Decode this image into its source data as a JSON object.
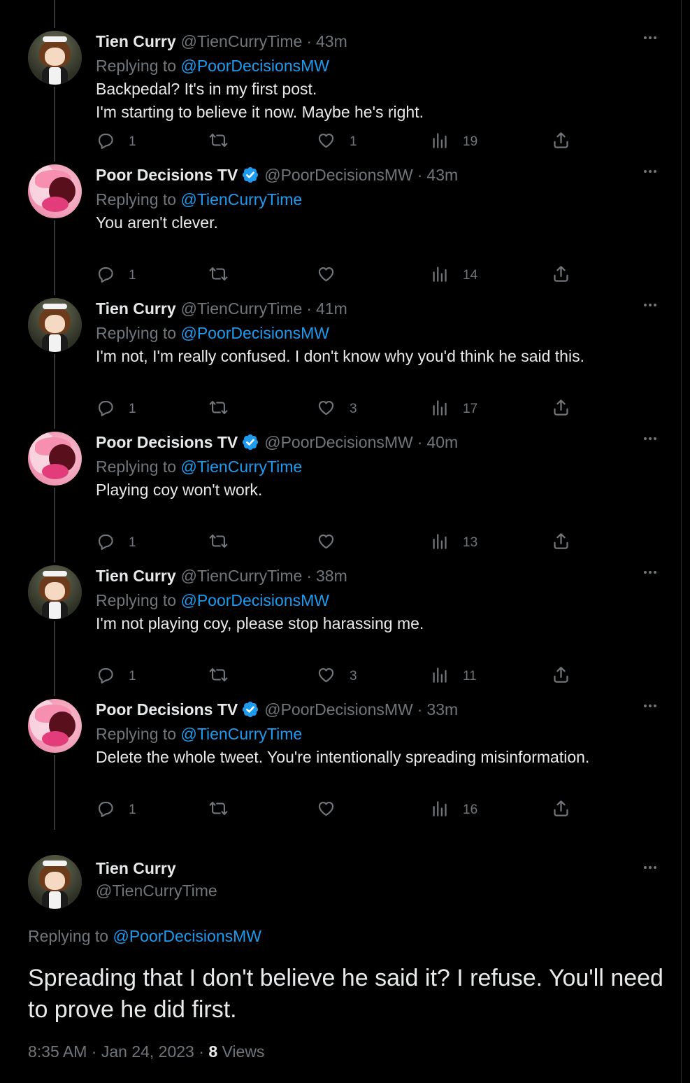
{
  "tweets": [
    {
      "author": "Tien Curry",
      "handle": "@TienCurryTime",
      "time": "43m",
      "verified": false,
      "replying_prefix": "Replying to",
      "replying_to": "@PoorDecisionsMW",
      "text": [
        "Backpedal? It's in my first post.",
        "I'm starting to believe it now. Maybe he's right."
      ],
      "replies": "1",
      "retweets": "",
      "likes": "1",
      "views": "19"
    },
    {
      "author": "Poor Decisions TV",
      "handle": "@PoorDecisionsMW",
      "time": "43m",
      "verified": true,
      "replying_prefix": "Replying to",
      "replying_to": "@TienCurryTime",
      "text": [
        "You aren't clever."
      ],
      "replies": "1",
      "retweets": "",
      "likes": "",
      "views": "14"
    },
    {
      "author": "Tien Curry",
      "handle": "@TienCurryTime",
      "time": "41m",
      "verified": false,
      "replying_prefix": "Replying to",
      "replying_to": "@PoorDecisionsMW",
      "text": [
        "I'm not, I'm really confused. I don't know why you'd think he said this."
      ],
      "replies": "1",
      "retweets": "",
      "likes": "3",
      "views": "17"
    },
    {
      "author": "Poor Decisions TV",
      "handle": "@PoorDecisionsMW",
      "time": "40m",
      "verified": true,
      "replying_prefix": "Replying to",
      "replying_to": "@TienCurryTime",
      "text": [
        "Playing coy won't work."
      ],
      "replies": "1",
      "retweets": "",
      "likes": "",
      "views": "13"
    },
    {
      "author": "Tien Curry",
      "handle": "@TienCurryTime",
      "time": "38m",
      "verified": false,
      "replying_prefix": "Replying to",
      "replying_to": "@PoorDecisionsMW",
      "text": [
        "I'm not playing coy, please stop harassing me."
      ],
      "replies": "1",
      "retweets": "",
      "likes": "3",
      "views": "11"
    },
    {
      "author": "Poor Decisions TV",
      "handle": "@PoorDecisionsMW",
      "time": "33m",
      "verified": true,
      "replying_prefix": "Replying to",
      "replying_to": "@TienCurryTime",
      "text": [
        "Delete the whole tweet. You're intentionally spreading misinformation."
      ],
      "replies": "1",
      "retweets": "",
      "likes": "",
      "views": "16"
    }
  ],
  "main_tweet": {
    "author": "Tien Curry",
    "handle": "@TienCurryTime",
    "replying_prefix": "Replying to",
    "replying_to": "@PoorDecisionsMW",
    "text": "Spreading that I don't believe he said it? I refuse. You'll need to prove he did first.",
    "timestamp": "8:35 AM",
    "date": "Jan 24, 2023",
    "views_count": "8",
    "views_label": "Views",
    "separator": "·"
  },
  "colors": {
    "background": "#000000",
    "text": "#e7e9ea",
    "muted": "#71767b",
    "link": "#1d9bf0",
    "verified": "#1d9bf0",
    "divider": "#2f3336"
  },
  "icons": {
    "reply": "reply-bubble-icon",
    "retweet": "retweet-icon",
    "like": "heart-icon",
    "views": "views-bar-chart-icon",
    "share": "share-upload-icon",
    "more": "more-dots-icon",
    "verified": "verified-badge-icon"
  }
}
